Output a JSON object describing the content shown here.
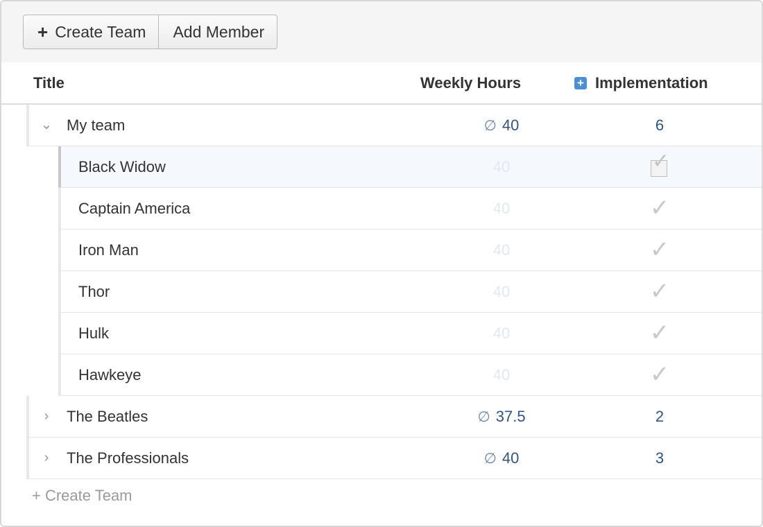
{
  "toolbar": {
    "create_team_icon": "plus-icon",
    "create_team_label": "Create Team",
    "add_member_label": "Add Member"
  },
  "columns": {
    "title": "Title",
    "weekly_hours": "Weekly Hours",
    "implementation_icon": "plus-square-icon",
    "implementation": "Implementation"
  },
  "teams": [
    {
      "name": "My team",
      "expanded": true,
      "avg_symbol": "∅",
      "hours": "40",
      "implementation": "6",
      "members": [
        {
          "name": "Black Widow",
          "hours": "40",
          "implementation_icon": "checkbox-checked-icon",
          "selected": true
        },
        {
          "name": "Captain America",
          "hours": "40",
          "implementation_icon": "check-icon"
        },
        {
          "name": "Iron Man",
          "hours": "40",
          "implementation_icon": "check-icon"
        },
        {
          "name": "Thor",
          "hours": "40",
          "implementation_icon": "check-icon"
        },
        {
          "name": "Hulk",
          "hours": "40",
          "implementation_icon": "check-icon"
        },
        {
          "name": "Hawkeye",
          "hours": "40",
          "implementation_icon": "check-icon"
        }
      ]
    },
    {
      "name": "The Beatles",
      "expanded": false,
      "avg_symbol": "∅",
      "hours": "37.5",
      "implementation": "2",
      "members": []
    },
    {
      "name": "The Professionals",
      "expanded": false,
      "avg_symbol": "∅",
      "hours": "40",
      "implementation": "3",
      "members": []
    }
  ],
  "footer": {
    "create_team_label": "+ Create Team"
  },
  "colors": {
    "link_blue": "#2f5488",
    "accent_blue": "#4a8fd6",
    "muted_text": "#9a9a9a"
  }
}
